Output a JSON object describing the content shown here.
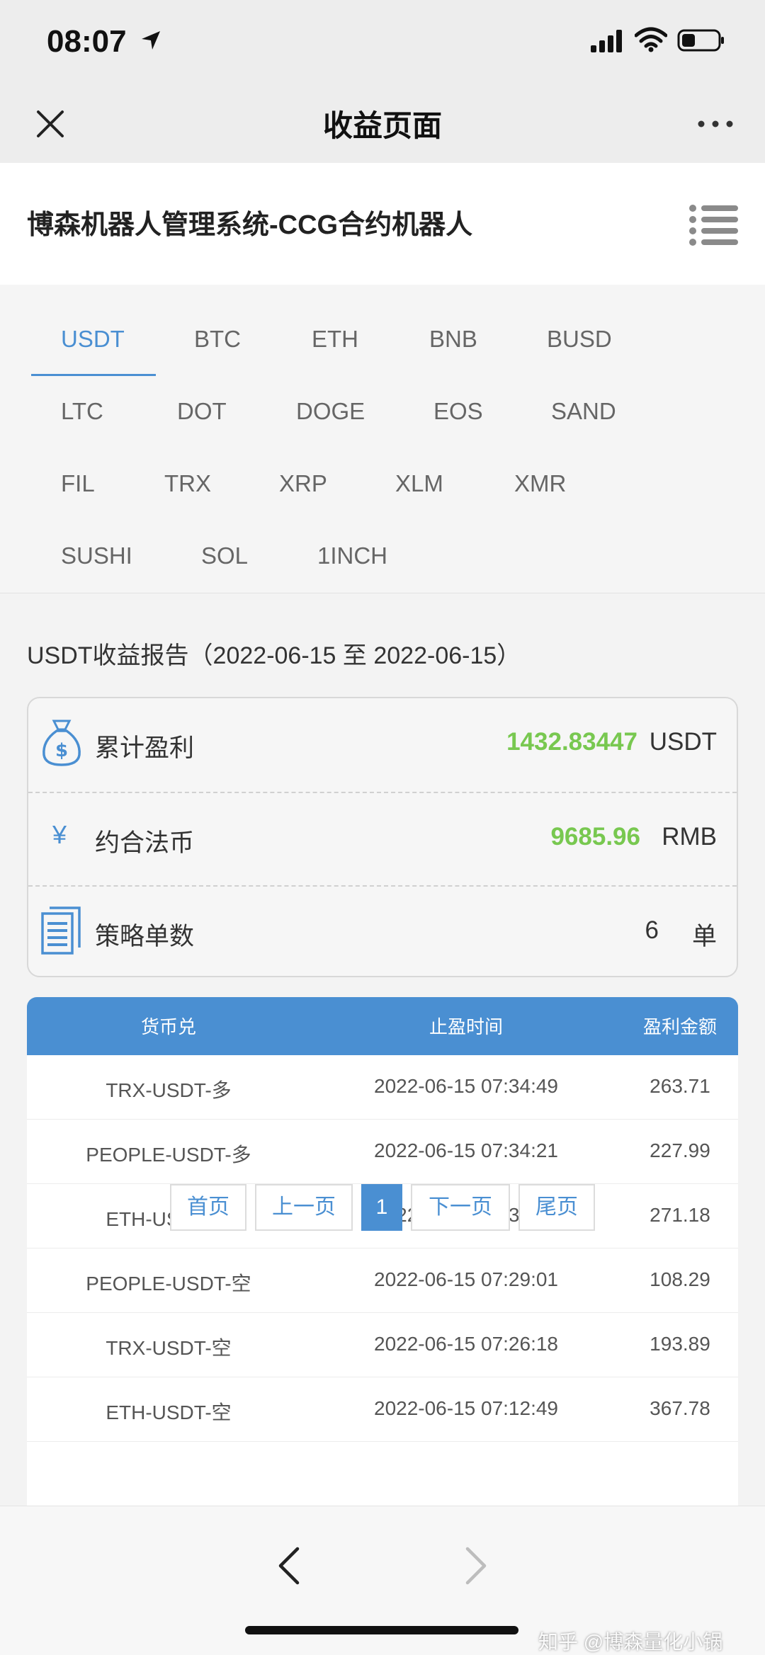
{
  "status_bar": {
    "time": "08:07"
  },
  "nav": {
    "title": "收益页面"
  },
  "app": {
    "title": "博森机器人管理系统-CCG合约机器人"
  },
  "tabs": {
    "active": "USDT",
    "items": [
      "USDT",
      "BTC",
      "ETH",
      "BNB",
      "BUSD",
      "LTC",
      "DOT",
      "DOGE",
      "EOS",
      "SAND",
      "FIL",
      "TRX",
      "XRP",
      "XLM",
      "XMR",
      "SUSHI",
      "SOL",
      "1INCH"
    ]
  },
  "report": {
    "title": "USDT收益报告（2022-06-15 至 2022-06-15）",
    "profit": {
      "label": "累计盈利",
      "value": "1432.83447",
      "unit": "USDT"
    },
    "fiat": {
      "label": "约合法币",
      "symbol": "¥",
      "value": "9685.96",
      "unit": "RMB"
    },
    "orders": {
      "label": "策略单数",
      "value": "6",
      "unit": "单"
    }
  },
  "table": {
    "headers": [
      "货币兑",
      "止盈时间",
      "盈利金额"
    ],
    "rows": [
      [
        "TRX-USDT-多",
        "2022-06-15 07:34:49",
        "263.71"
      ],
      [
        "PEOPLE-USDT-多",
        "2022-06-15 07:34:21",
        "227.99"
      ],
      [
        "ETH-USDT-多",
        "2022-06-15 07:32:18",
        "271.18"
      ],
      [
        "PEOPLE-USDT-空",
        "2022-06-15 07:29:01",
        "108.29"
      ],
      [
        "TRX-USDT-空",
        "2022-06-15 07:26:18",
        "193.89"
      ],
      [
        "ETH-USDT-空",
        "2022-06-15 07:12:49",
        "367.78"
      ]
    ]
  },
  "pagination": {
    "first": "首页",
    "prev": "上一页",
    "current": "1",
    "next": "下一页",
    "last": "尾页"
  },
  "watermark": "知乎 @博森量化小锅",
  "colors": {
    "accent": "#4a8fd2",
    "profit_green": "#78c850"
  }
}
